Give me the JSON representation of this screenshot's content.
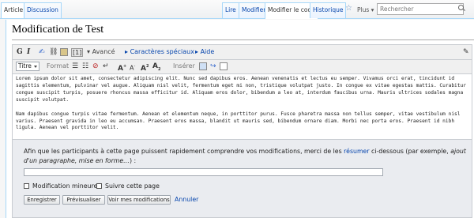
{
  "tabs_left": {
    "article": "Article",
    "discussion": "Discussion"
  },
  "tabs_right": {
    "read": "Lire",
    "edit": "Modifier",
    "edit_source": "Modifier le code",
    "history": "Historique",
    "more": "Plus",
    "search_placeholder": "Rechercher"
  },
  "page": {
    "title": "Modification de Test"
  },
  "toolbar": {
    "bold": "G",
    "italic": "I",
    "advanced": "Avancé",
    "special_chars": "Caractères spéciaux",
    "help": "Aide",
    "heading_select": "Titre",
    "format_label": "Format",
    "insert_label": "Insérer",
    "font_big": "A",
    "font_small": "A",
    "superscript": "A",
    "subscript": "A"
  },
  "editor": {
    "paragraph1": "Lorem ipsum dolor sit amet, consectetur adipiscing elit. Nunc sed dapibus eros. Aenean venenatis et lectus eu semper. Vivamus orci erat, tincidunt id sagittis elementum, pulvinar vel augue. Aliquam nisl velit, fermentum eget mi non, tristique volutpat justo. In congue ex vitae egestas mattis. Curabitur congue suscipit turpis, posuere rhoncus massa efficitur id. Aliquam eros dolor, bibendum a leo at, interdum faucibus urna. Mauris ultrices sodales magna suscipit volutpat.",
    "paragraph2": "Nam dapibus congue turpis vitae fermentum. Aenean et elementum neque, in porttitor purus. Fusce pharetra massa non tellus semper, vitae vestibulum nisl varius. Praesent gravida in leo eu accumsan. Praesent eros massa, blandit ut mauris sed, bibendum ornare diam. Morbi nec porta eros. Praesent id nibh ligula. Aenean vel porttitor velit."
  },
  "save": {
    "summary_pre": "Afin que les participants à cette page puissent rapidement comprendre vos modifications, merci de les ",
    "summary_link": "résumer",
    "summary_mid": " ci-dessous (par exemple, ",
    "summary_italic": "ajout d'un paragraphe, mise en forme…",
    "summary_post": ") :",
    "summary_value": "",
    "minor_edit": "Modification mineure",
    "watch": "Suivre cette page",
    "save_button": "Enregistrer",
    "preview_button": "Prévisualiser",
    "diff_button": "Voir mes modifications",
    "cancel": "Annuler"
  },
  "colors": {
    "link": "#0645ad",
    "tab_border": "#a7d7f9",
    "panel": "#eaecf0"
  },
  "icons": [
    "search-icon",
    "star-icon",
    "signature-icon",
    "link-icon",
    "embedded-file-icon",
    "reference-icon",
    "bullet-list-icon",
    "numbered-list-icon",
    "no-wiki-icon",
    "line-break-icon",
    "gallery-icon",
    "redirect-icon",
    "table-icon",
    "search-replace-icon"
  ]
}
